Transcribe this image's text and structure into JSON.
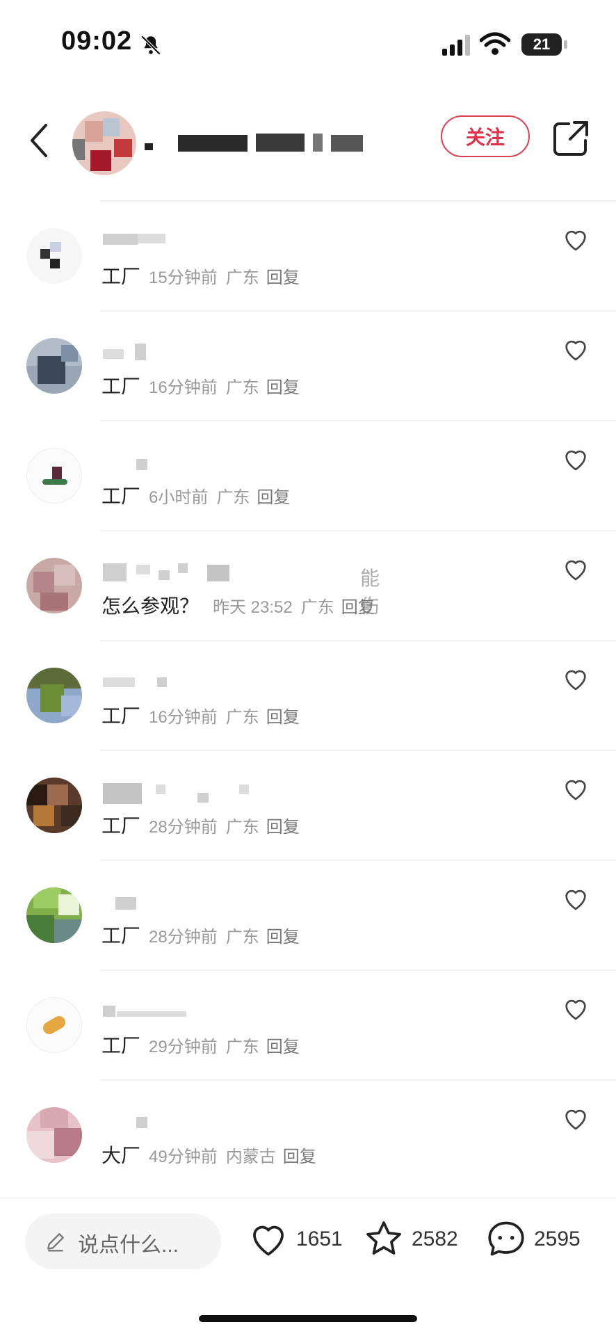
{
  "status_bar": {
    "time": "09:02",
    "battery": "21"
  },
  "header": {
    "follow_label": "关注"
  },
  "comments": [
    {
      "content": "工厂",
      "time": "15分钟前",
      "location": "广东",
      "reply": "回复"
    },
    {
      "content": "工厂",
      "time": "16分钟前",
      "location": "广东",
      "reply": "回复"
    },
    {
      "content": "工厂",
      "time": "6小时前",
      "location": "广东",
      "reply": "回复"
    },
    {
      "content": "怎么参观？",
      "time": "昨天 23:52",
      "location": "广东",
      "reply": "回复",
      "username_tail": "能伤"
    },
    {
      "content": "工厂",
      "time": "16分钟前",
      "location": "广东",
      "reply": "回复"
    },
    {
      "content": "工厂",
      "time": "28分钟前",
      "location": "广东",
      "reply": "回复"
    },
    {
      "content": "工厂",
      "time": "28分钟前",
      "location": "广东",
      "reply": "回复"
    },
    {
      "content": "工厂",
      "time": "29分钟前",
      "location": "广东",
      "reply": "回复"
    },
    {
      "content": "大厂",
      "time": "49分钟前",
      "location": "内蒙古",
      "reply": "回复"
    }
  ],
  "bottom_bar": {
    "placeholder": "说点什么...",
    "likes": "1651",
    "favorites": "2582",
    "comments": "2595"
  },
  "colors": {
    "accent": "#e0304a"
  },
  "icons": [
    "bell-muted-icon",
    "signal-icon",
    "wifi-icon",
    "back-icon",
    "share-icon",
    "heart-icon",
    "pencil-icon",
    "star-icon",
    "comment-bubble-icon"
  ]
}
